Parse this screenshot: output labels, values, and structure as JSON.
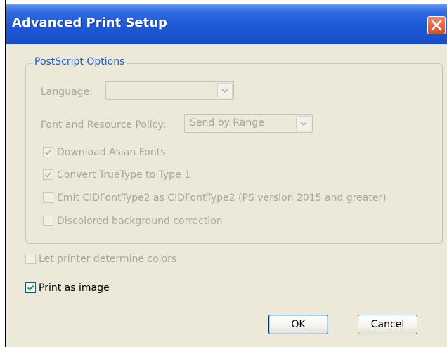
{
  "window": {
    "title": "Advanced Print Setup"
  },
  "postscript_group": {
    "legend": "PostScript Options",
    "language": {
      "label": "Language:",
      "value": ""
    },
    "font_policy": {
      "label": "Font and Resource Policy:",
      "value": "Send by Range"
    },
    "options": [
      {
        "label": "Download Asian Fonts",
        "checked": true,
        "enabled": false
      },
      {
        "label": "Convert TrueType to Type 1",
        "checked": true,
        "enabled": false
      },
      {
        "label": "Emit CIDFontType2 as CIDFontType2 (PS version 2015 and greater)",
        "checked": false,
        "enabled": false
      },
      {
        "label": "Discolored background correction",
        "checked": false,
        "enabled": false
      }
    ]
  },
  "printer_colors": {
    "label": "Let printer determine colors",
    "checked": false,
    "enabled": false
  },
  "print_as_image": {
    "label": "Print as image",
    "checked": true,
    "enabled": true
  },
  "buttons": {
    "ok": "OK",
    "cancel": "Cancel"
  }
}
